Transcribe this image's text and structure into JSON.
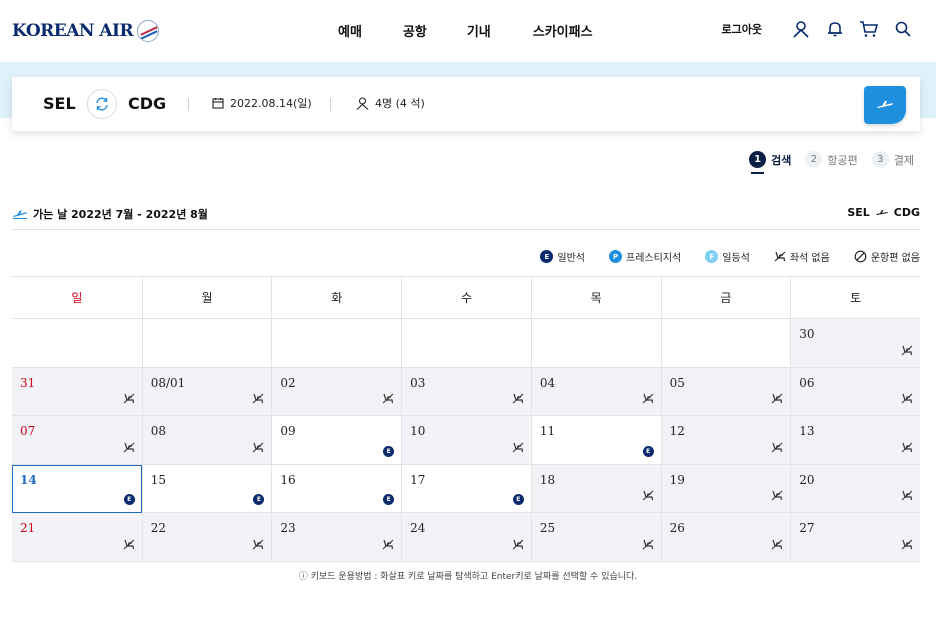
{
  "header": {
    "logo_text": "KOREAN AIR",
    "nav": [
      "예매",
      "공항",
      "기내",
      "스카이패스"
    ],
    "logout_label": "로그아웃"
  },
  "search": {
    "origin": "SEL",
    "destination": "CDG",
    "date": "2022.08.14(일)",
    "passengers": "4명 (4 석)"
  },
  "steps": [
    {
      "num": "1",
      "label": "검색",
      "active": true
    },
    {
      "num": "2",
      "label": "항공편",
      "active": false
    },
    {
      "num": "3",
      "label": "결제",
      "active": false
    }
  ],
  "section": {
    "title": "가는 날  2022년 7월 - 2022년 8월",
    "route_from": "SEL",
    "route_to": "CDG"
  },
  "legend": [
    {
      "mark": "E",
      "label": "일반석",
      "type": "e"
    },
    {
      "mark": "P",
      "label": "프레스티지석",
      "type": "p"
    },
    {
      "mark": "F",
      "label": "일등석",
      "type": "f"
    },
    {
      "mark": "no-seat",
      "label": "좌석 없음",
      "type": "noseat"
    },
    {
      "mark": "no-flight",
      "label": "운항편 없음",
      "type": "noflight"
    }
  ],
  "calendar": {
    "weekdays": [
      "일",
      "월",
      "화",
      "수",
      "목",
      "금",
      "토"
    ],
    "weeks": [
      [
        {
          "day": ""
        },
        {
          "day": ""
        },
        {
          "day": ""
        },
        {
          "day": ""
        },
        {
          "day": ""
        },
        {
          "day": ""
        },
        {
          "day": "30",
          "status": "noseat"
        }
      ],
      [
        {
          "day": "31",
          "status": "noseat"
        },
        {
          "day": "08/01",
          "status": "noseat"
        },
        {
          "day": "02",
          "status": "noseat"
        },
        {
          "day": "03",
          "status": "noseat"
        },
        {
          "day": "04",
          "status": "noseat"
        },
        {
          "day": "05",
          "status": "noseat"
        },
        {
          "day": "06",
          "status": "noseat"
        }
      ],
      [
        {
          "day": "07",
          "status": "noseat"
        },
        {
          "day": "08",
          "status": "noseat"
        },
        {
          "day": "09",
          "status": "E"
        },
        {
          "day": "10",
          "status": "noseat"
        },
        {
          "day": "11",
          "status": "E"
        },
        {
          "day": "12",
          "status": "noseat"
        },
        {
          "day": "13",
          "status": "noseat"
        }
      ],
      [
        {
          "day": "14",
          "status": "E",
          "selected": true
        },
        {
          "day": "15",
          "status": "E"
        },
        {
          "day": "16",
          "status": "E"
        },
        {
          "day": "17",
          "status": "E"
        },
        {
          "day": "18",
          "status": "noseat"
        },
        {
          "day": "19",
          "status": "noseat"
        },
        {
          "day": "20",
          "status": "noseat"
        }
      ],
      [
        {
          "day": "21",
          "status": "noseat"
        },
        {
          "day": "22",
          "status": "noseat"
        },
        {
          "day": "23",
          "status": "noseat"
        },
        {
          "day": "24",
          "status": "noseat"
        },
        {
          "day": "25",
          "status": "noseat"
        },
        {
          "day": "26",
          "status": "noseat"
        },
        {
          "day": "27",
          "status": "noseat"
        }
      ]
    ]
  },
  "keyboard_note": "ⓘ 키보드 운용방법 : 화살표 키로 날짜를 탐색하고 Enter키로 날짜를 선택할 수 있습니다.",
  "colors": {
    "navy": "#0a2b6e",
    "accent": "#1f8fe0",
    "sunday": "#d0021b",
    "band": "#dff1fb"
  }
}
